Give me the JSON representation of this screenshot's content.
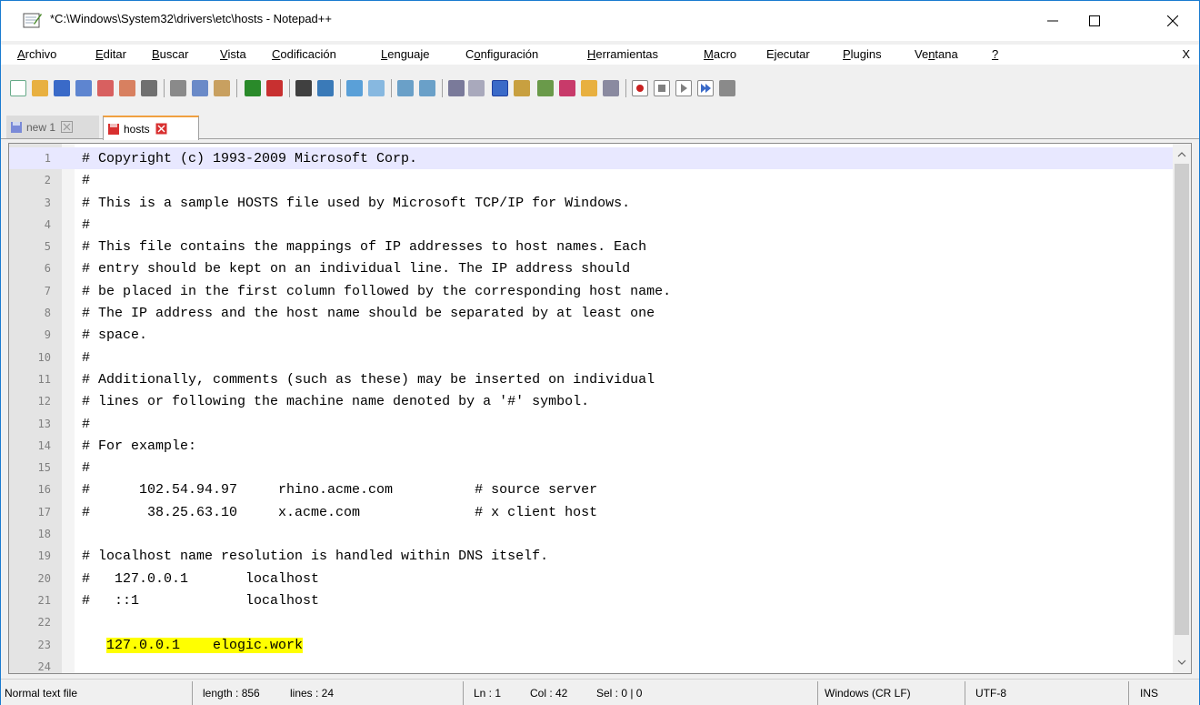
{
  "window": {
    "title": "*C:\\Windows\\System32\\drivers\\etc\\hosts - Notepad++",
    "controls": {
      "minimize": "—",
      "maximize": "☐",
      "close": "✕"
    }
  },
  "menu": {
    "items": [
      {
        "label": "Archivo",
        "ul": "A",
        "rest": "rchivo"
      },
      {
        "label": "Editar",
        "ul": "E",
        "rest": "ditar"
      },
      {
        "label": "Buscar",
        "ul": "B",
        "rest": "uscar"
      },
      {
        "label": "Vista",
        "ul": "V",
        "rest": "ista"
      },
      {
        "label": "Codificación",
        "ul": "C",
        "rest": "odificación"
      },
      {
        "label": "Lenguaje",
        "ul": "L",
        "rest": "enguaje"
      },
      {
        "label": "Configuración",
        "ul": "o",
        "pre": "C",
        "rest": "nfiguración"
      },
      {
        "label": "Herramientas",
        "ul": "H",
        "rest": "erramientas"
      },
      {
        "label": "Macro",
        "ul": "M",
        "rest": "acro"
      },
      {
        "label": "Ejecutar",
        "ul": "j",
        "pre": "E",
        "rest": "ecutar"
      },
      {
        "label": "Plugins",
        "ul": "P",
        "rest": "lugins"
      },
      {
        "label": "Ventana",
        "ul": "n",
        "pre": "Ve",
        "rest": "tana"
      },
      {
        "label": "?",
        "ul": "?",
        "rest": ""
      }
    ],
    "doc_close": "X"
  },
  "tabs": [
    {
      "label": "new 1",
      "active": false
    },
    {
      "label": "hosts",
      "active": true
    }
  ],
  "editor": {
    "lines": [
      {
        "n": "1",
        "text": "# Copyright (c) 1993-2009 Microsoft Corp."
      },
      {
        "n": "2",
        "text": "#"
      },
      {
        "n": "3",
        "text": "# This is a sample HOSTS file used by Microsoft TCP/IP for Windows."
      },
      {
        "n": "4",
        "text": "#"
      },
      {
        "n": "5",
        "text": "# This file contains the mappings of IP addresses to host names. Each"
      },
      {
        "n": "6",
        "text": "# entry should be kept on an individual line. The IP address should"
      },
      {
        "n": "7",
        "text": "# be placed in the first column followed by the corresponding host name."
      },
      {
        "n": "8",
        "text": "# The IP address and the host name should be separated by at least one"
      },
      {
        "n": "9",
        "text": "# space."
      },
      {
        "n": "10",
        "text": "#"
      },
      {
        "n": "11",
        "text": "# Additionally, comments (such as these) may be inserted on individual"
      },
      {
        "n": "12",
        "text": "# lines or following the machine name denoted by a '#' symbol."
      },
      {
        "n": "13",
        "text": "#"
      },
      {
        "n": "14",
        "text": "# For example:"
      },
      {
        "n": "15",
        "text": "#"
      },
      {
        "n": "16",
        "text": "#      102.54.94.97     rhino.acme.com          # source server"
      },
      {
        "n": "17",
        "text": "#       38.25.63.10     x.acme.com              # x client host"
      },
      {
        "n": "18",
        "text": ""
      },
      {
        "n": "19",
        "text": "# localhost name resolution is handled within DNS itself."
      },
      {
        "n": "20",
        "text": "#   127.0.0.1       localhost"
      },
      {
        "n": "21",
        "text": "#   ::1             localhost"
      },
      {
        "n": "22",
        "text": ""
      },
      {
        "n": "23",
        "text": "",
        "highlight": "127.0.0.1    elogic.work"
      },
      {
        "n": "24",
        "text": ""
      }
    ],
    "current_line": "1",
    "highlight_color": "#ffff00"
  },
  "status": {
    "file_type": "Normal text file",
    "length": "length : 856",
    "lines": "lines : 24",
    "ln": "Ln : 1",
    "col": "Col : 42",
    "sel": "Sel : 0 | 0",
    "eol": "Windows (CR LF)",
    "encoding": "UTF-8",
    "mode": "INS"
  },
  "toolbar": {
    "icons": [
      "new-file-icon",
      "open-file-icon",
      "save-icon",
      "save-all-icon",
      "close-icon",
      "close-all-icon",
      "print-icon",
      "cut-icon",
      "copy-icon",
      "paste-icon",
      "undo-icon",
      "redo-icon",
      "find-icon",
      "replace-icon",
      "zoom-in-icon",
      "zoom-out-icon",
      "sync-vertical-icon",
      "sync-horizontal-icon",
      "word-wrap-icon",
      "show-all-chars-icon",
      "indent-guide-icon",
      "user-define-lang-icon",
      "doc-map-icon",
      "function-list-icon",
      "folder-workspace-icon",
      "monitoring-icon",
      "record-macro-icon",
      "stop-record-icon",
      "play-macro-icon",
      "play-multiple-icon",
      "save-macro-icon"
    ]
  }
}
